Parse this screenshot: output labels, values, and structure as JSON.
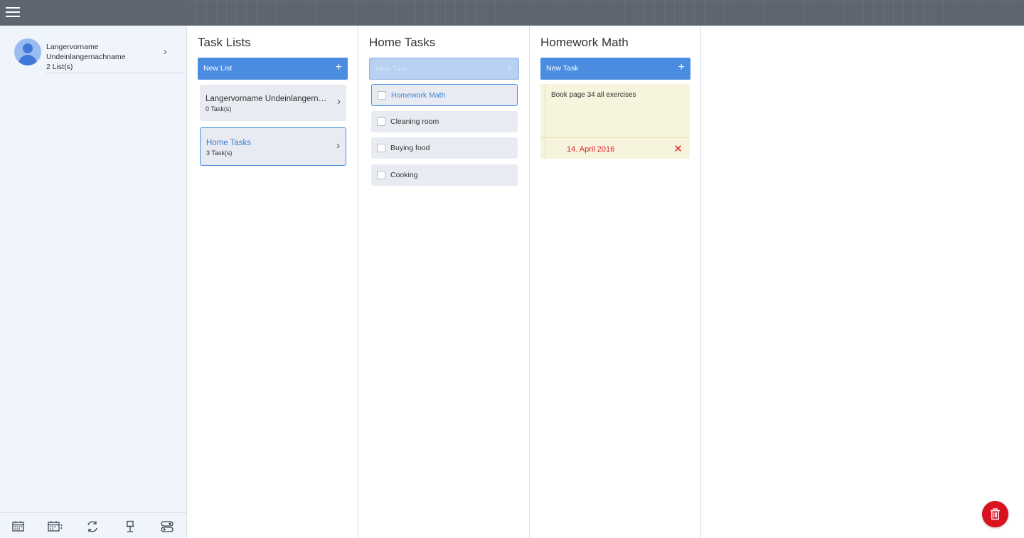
{
  "profile": {
    "first_name": "Langervorname",
    "last_name": "Undeinlangernachname",
    "list_count": "2 List(s)"
  },
  "columns": {
    "task_lists": {
      "title": "Task Lists",
      "new_label": "New List",
      "items": [
        {
          "title": "Langervorname Undeinlangernachname",
          "count": "0 Task(s)"
        },
        {
          "title": "Home Tasks",
          "count": "3 Task(s)"
        }
      ]
    },
    "home_tasks": {
      "title": "Home Tasks",
      "new_label": "New Task",
      "tasks": [
        {
          "label": "Homework Math"
        },
        {
          "label": "Cleaning room"
        },
        {
          "label": "Buying food"
        },
        {
          "label": "Cooking"
        }
      ]
    },
    "homework_math": {
      "title": "Homework Math",
      "new_label": "New Task",
      "note": {
        "text": "Book page 34 all exercises",
        "date": "14. April 2016"
      }
    }
  },
  "icons": {
    "menu": "hamburger-icon",
    "plus": "+",
    "chevron": "›",
    "close": "✕"
  },
  "colors": {
    "accent": "#4a8de0",
    "danger": "#d9121f",
    "topbar": "#5d6670",
    "sidebar": "#f0f4fb",
    "note": "#f6f4dc"
  }
}
